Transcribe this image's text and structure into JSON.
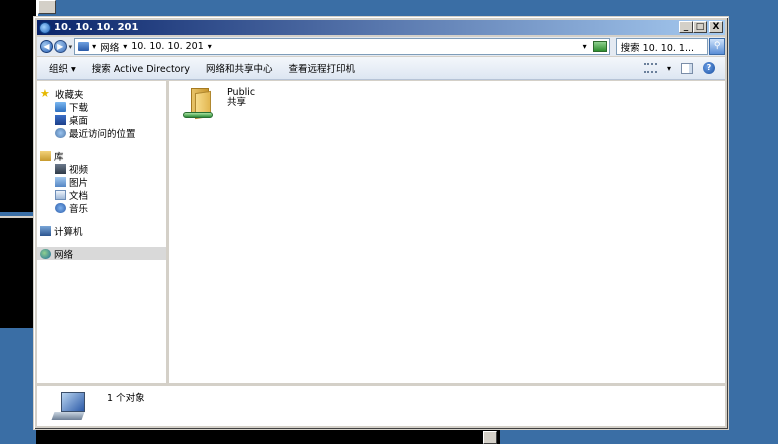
{
  "window": {
    "title": "10. 10. 10. 201",
    "buttons": {
      "minimize": "_",
      "maximize": "□",
      "close": "X"
    }
  },
  "address_bar": {
    "back_icon": "back-arrow-icon",
    "forward_icon": "forward-arrow-icon",
    "breadcrumbs": [
      "网络",
      "10. 10. 10. 201"
    ],
    "search_placeholder": "搜索 10. 10. 1..."
  },
  "command_bar": {
    "items": [
      "组织 ▾",
      "搜索 Active Directory",
      "网络和共享中心",
      "查看远程打印机"
    ]
  },
  "nav_pane": {
    "favorites": {
      "label": "收藏夹",
      "items": [
        "下载",
        "桌面",
        "最近访问的位置"
      ]
    },
    "libraries": {
      "label": "库",
      "items": [
        "视频",
        "图片",
        "文档",
        "音乐"
      ]
    },
    "computer": "计算机",
    "network": "网络"
  },
  "content": {
    "items": [
      {
        "name": "Public",
        "type": "共享",
        "icon": "shared-folder-icon"
      }
    ]
  },
  "details_pane": {
    "count": "1 个对象"
  },
  "colors": {
    "desktop": "#3a6ea5",
    "title_start": "#0a246a",
    "title_end": "#a6caf0",
    "selection": "#d9d9d9"
  }
}
